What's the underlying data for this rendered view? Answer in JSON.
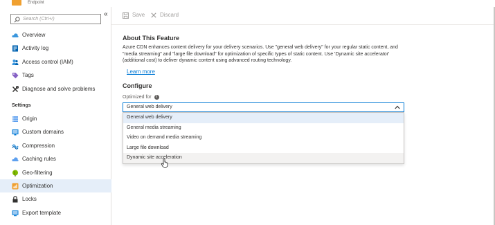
{
  "resource": {
    "subtitle": "Endpoint"
  },
  "sidebar": {
    "search_placeholder": "Search (Ctrl+/)",
    "collapse_glyph": "«",
    "items_top": [
      {
        "label": "Overview",
        "icon": "cloud-overview-icon"
      },
      {
        "label": "Activity log",
        "icon": "activity-log-icon"
      },
      {
        "label": "Access control (IAM)",
        "icon": "people-icon"
      },
      {
        "label": "Tags",
        "icon": "tag-icon"
      },
      {
        "label": "Diagnose and solve problems",
        "icon": "wrench-icon"
      }
    ],
    "settings_header": "Settings",
    "items_settings": [
      {
        "label": "Origin",
        "icon": "origin-icon"
      },
      {
        "label": "Custom domains",
        "icon": "custom-domains-icon"
      },
      {
        "label": "Compression",
        "icon": "compression-icon"
      },
      {
        "label": "Caching rules",
        "icon": "cloud-icon"
      },
      {
        "label": "Geo-filtering",
        "icon": "globe-icon"
      },
      {
        "label": "Optimization",
        "icon": "optimization-icon",
        "active": true
      },
      {
        "label": "Locks",
        "icon": "lock-icon"
      },
      {
        "label": "Export template",
        "icon": "export-template-icon"
      }
    ]
  },
  "toolbar": {
    "save_label": "Save",
    "discard_label": "Discard"
  },
  "about": {
    "title": "About This Feature",
    "text": "Azure CDN enhances content delivery for your delivery scenarios. Use \"general web delivery\" for your regular static content, and \"media streaming\" and \"large file download\" for optimization of specific types of static content. Use 'Dynamic site accelerator' (additional cost) to deliver dynamic content using advanced routing technology.",
    "learn_more": "Learn more"
  },
  "configure": {
    "title": "Configure",
    "optimized_for_label": "Optimized for",
    "selected_value": "General web delivery",
    "options": [
      "General web delivery",
      "General media streaming",
      "Video on demand media streaming",
      "Large file download",
      "Dynamic site acceleration"
    ]
  },
  "colors": {
    "accent": "#0078d4",
    "active_bg": "#e5eef9",
    "resource_icon": "#f0a030"
  }
}
